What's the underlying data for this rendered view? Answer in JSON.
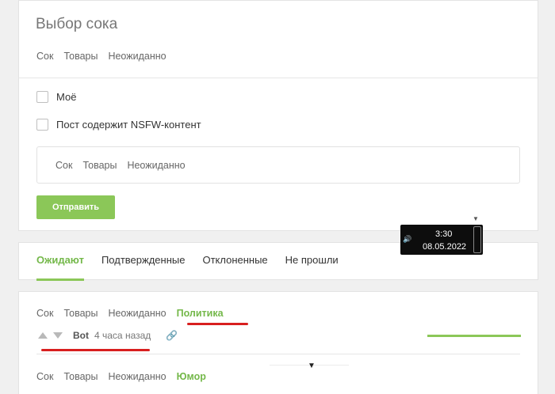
{
  "form": {
    "title": "Выбор сока",
    "tags": [
      "Сок",
      "Товары",
      "Неожиданно"
    ],
    "checkboxes": {
      "mine": "Моё",
      "nsfw": "Пост содержит NSFW-контент"
    },
    "tag_input": [
      "Сок",
      "Товары",
      "Неожиданно"
    ],
    "submit_label": "Отправить"
  },
  "tabs": [
    "Ожидают",
    "Подтвержденные",
    "Отклоненные",
    "Не прошли"
  ],
  "posts": [
    {
      "tags": [
        "Сок",
        "Товары",
        "Неожиданно",
        "Политика"
      ],
      "author": "Bot",
      "time": "4 часа назад"
    },
    {
      "tags": [
        "Сок",
        "Товары",
        "Неожиданно",
        "Юмор"
      ]
    }
  ],
  "taskbar": {
    "time": "3:30",
    "date": "08.05.2022"
  },
  "colors": {
    "accent": "#8bc758",
    "annotation": "#d81f1f"
  }
}
